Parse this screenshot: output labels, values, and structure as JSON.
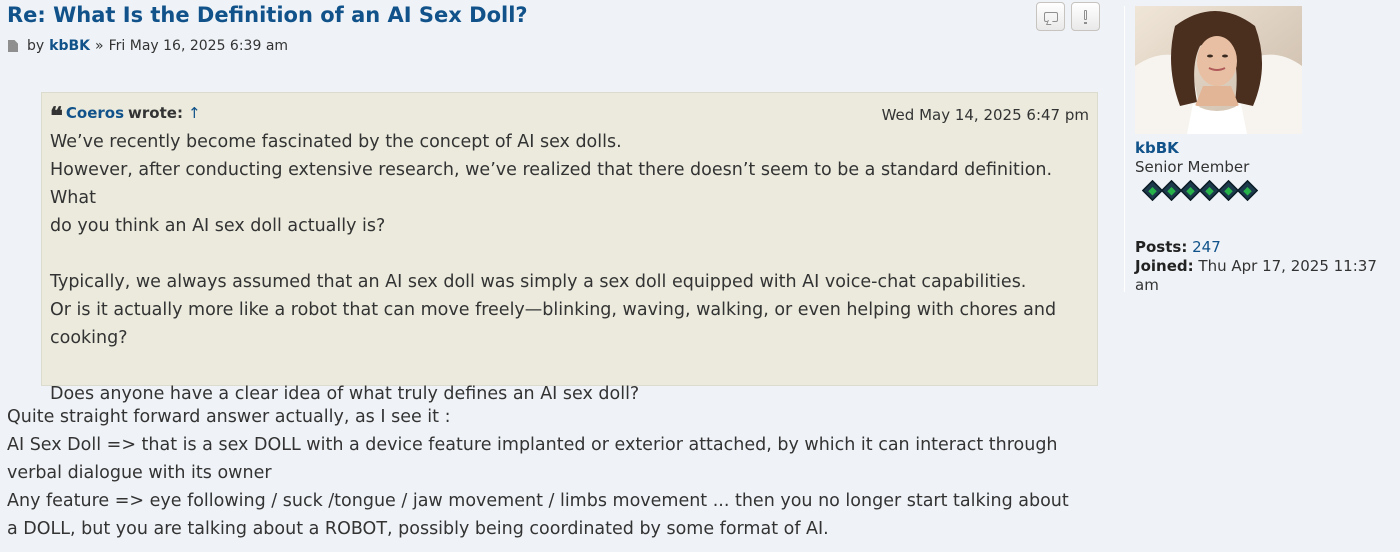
{
  "post": {
    "title": "Re: What Is the Definition of an AI Sex Doll?",
    "by": "by",
    "author": "kbBK",
    "separator": "»",
    "date": "Fri May 16, 2025 6:39 am"
  },
  "buttons": {
    "quote": "quote-icon",
    "report": "report-icon"
  },
  "quote": {
    "author": "Coeros",
    "wrote": "wrote:",
    "arrow": "↑",
    "date": "Wed May 14, 2025 6:47 pm",
    "lines": [
      "We’ve recently become fascinated by the concept of AI sex dolls.",
      "However, after conducting extensive research, we’ve realized that there doesn’t seem to be a standard definition. What",
      "do you think an AI sex doll actually is?",
      "",
      "Typically, we always assumed that an AI sex doll was simply a sex doll equipped with AI voice-chat capabilities.",
      "Or is it actually more like a robot that can move freely—blinking, waving, walking, or even helping with chores and",
      "cooking?",
      "",
      "Does anyone have a clear idea of what truly defines an AI sex doll?"
    ]
  },
  "reply": {
    "lines": [
      "Quite straight forward answer actually, as I see it :",
      "AI Sex Doll => that is a sex DOLL with a device feature implanted or exterior attached, by which it can interact through",
      "verbal dialogue with its owner",
      "Any feature => eye following / suck /tongue / jaw movement / limbs movement ... then you no longer start talking about",
      "a DOLL, but you are talking about a ROBOT, possibly being coordinated by some format of AI."
    ]
  },
  "profile": {
    "username": "kbBK",
    "rank": "Senior Member",
    "rank_stars": 6,
    "posts_label": "Posts:",
    "posts": "247",
    "joined_label": "Joined:",
    "joined_line1": "Thu Apr 17, 2025 11:37",
    "joined_line2": "am"
  },
  "colors": {
    "link": "#105289",
    "quote_bg": "#ebeadd",
    "page_bg": "#eff3f7",
    "rank_green": "#28b34a"
  }
}
